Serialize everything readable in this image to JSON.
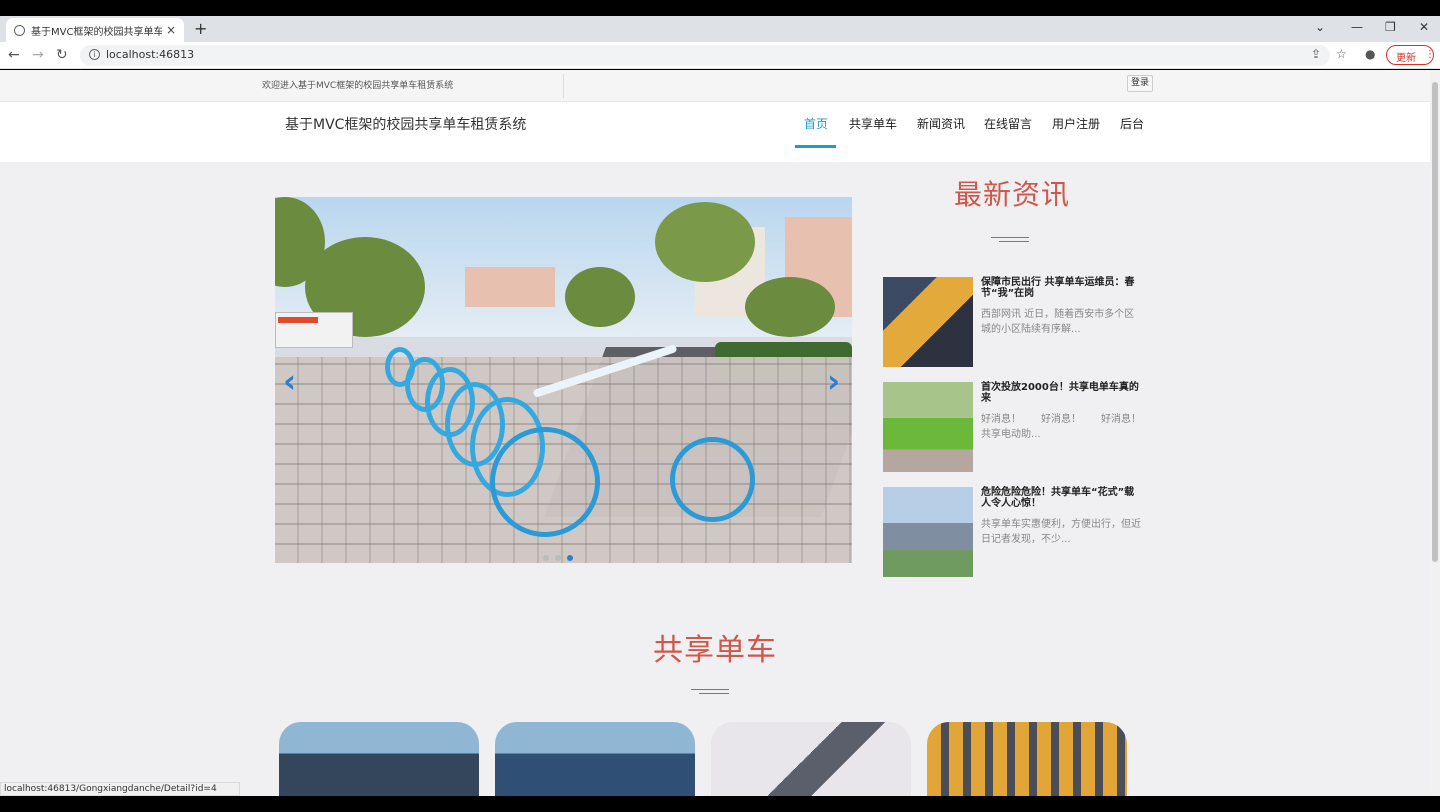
{
  "browser": {
    "tab_title": "基于MVC框架的校园共享单车租赁系统",
    "tab_close": "×",
    "new_tab": "+",
    "url": "localhost:46813",
    "update_label": "更新",
    "status_url": "localhost:46813/Gongxiangdanche/Detail?id=4"
  },
  "topbar": {
    "welcome": "欢迎进入基于MVC框架的校园共享单车租赁系统",
    "login": "登录"
  },
  "header": {
    "brand": "基于MVC框架的校园共享单车租赁系统",
    "nav": [
      {
        "label": "首页",
        "active": true
      },
      {
        "label": "共享单车"
      },
      {
        "label": "新闻资讯"
      },
      {
        "label": "在线留言"
      },
      {
        "label": "用户注册"
      },
      {
        "label": "后台"
      }
    ]
  },
  "carousel": {
    "prev_icon": "‹",
    "next_icon": "›",
    "slide_count": 3,
    "active_slide": 3
  },
  "news": {
    "title": "最新资讯",
    "items": [
      {
        "title": "保障市民出行 共享单车运维员：春节“我”在岗",
        "summary": "西部网讯 近日，随着西安市多个区城的小区陆续有序解..."
      },
      {
        "title": "首次投放2000台！共享电单车真的来",
        "summary": "好消息！　　好消息！　　好消息！　　共享电动助..."
      },
      {
        "title": "危险危险危险！共享单车“花式”载人令人心惊！",
        "summary": "共享单车实惠便利，方便出行，但近日记者发现，不少..."
      }
    ]
  },
  "bikes_section": {
    "title": "共享单车"
  },
  "colors": {
    "accent": "#1e9ec7",
    "section_red": "#d0574b"
  }
}
